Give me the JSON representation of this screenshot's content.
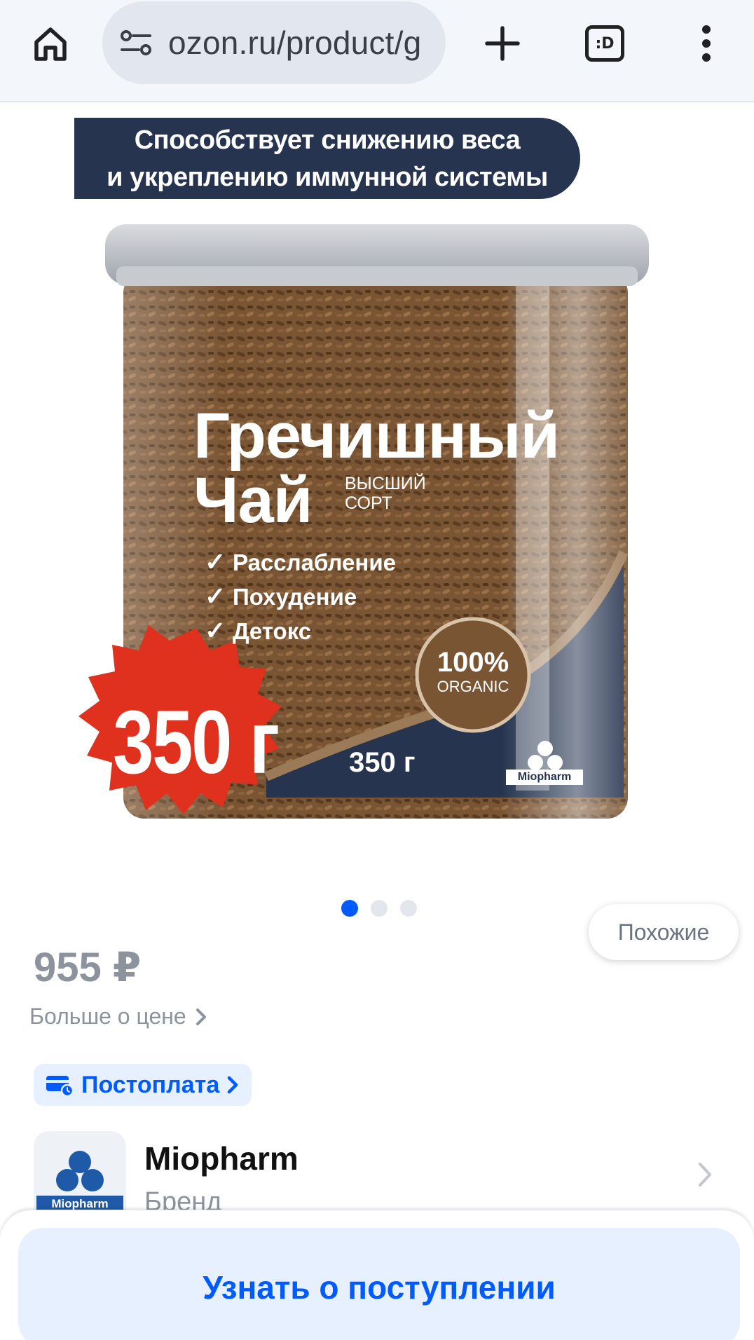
{
  "browser": {
    "url": "ozon.ru/product/g",
    "tabs_label": ":D",
    "icons": [
      "home-icon",
      "site-settings-icon",
      "new-tab-plus-icon",
      "tab-switcher-icon",
      "more-vert-icon"
    ]
  },
  "product_image": {
    "banner_line1": "Способствует снижению веса",
    "banner_line2": "и укреплению иммунной системы",
    "title_line1": "Гречишный",
    "title_line2": "Чай",
    "grade_line1": "ВЫСШИЙ",
    "grade_line2": "СОРТ",
    "benefits": [
      "Расслабление",
      "Похудение",
      "Детокс"
    ],
    "organic_pct": "100%",
    "organic_label": "ORGANIC",
    "jar_weight": "350 г",
    "jar_brand": "Miopharm",
    "badge_weight": "350 г",
    "colors": {
      "navy": "#26344f",
      "badge_red": "#e0301e",
      "tea_brown": "#6b4a2b"
    }
  },
  "similar_button": "Похожие",
  "gallery": {
    "dot_count": 3,
    "active_index": 0
  },
  "price": {
    "value": "955 ₽",
    "more_label": "Больше о цене"
  },
  "postpay": {
    "label": "Постоплата"
  },
  "brand": {
    "name": "Miopharm",
    "subtitle": "Бренд",
    "logo_text": "Miopharm"
  },
  "bottom_action": {
    "label": "Узнать о поступлении"
  },
  "colors": {
    "accent": "#005bff",
    "accent_bg": "#e6f0ff",
    "muted": "#8c939d"
  }
}
